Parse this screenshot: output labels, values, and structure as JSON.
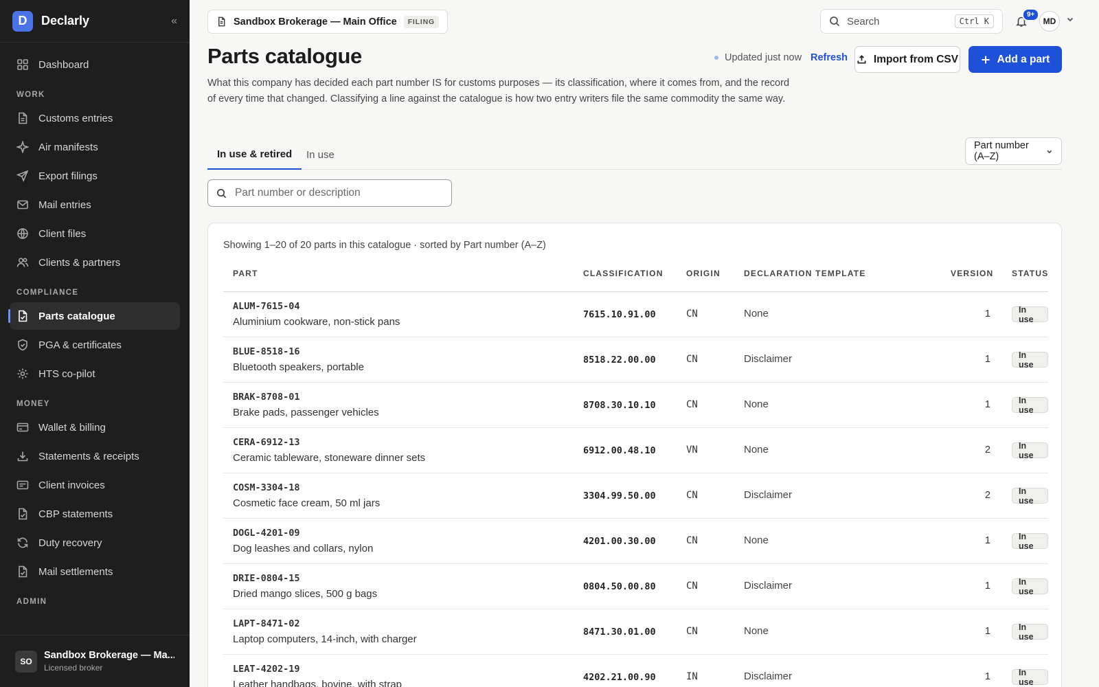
{
  "app": {
    "name": "Declarly",
    "logo_letter": "D"
  },
  "sidebar": {
    "top_items": [
      {
        "label": "Dashboard",
        "icon": "grid-icon"
      }
    ],
    "sections": [
      {
        "title": "WORK",
        "items": [
          {
            "label": "Customs entries",
            "icon": "document-icon"
          },
          {
            "label": "Air manifests",
            "icon": "sparkle-icon"
          },
          {
            "label": "Export filings",
            "icon": "send-icon"
          },
          {
            "label": "Mail entries",
            "icon": "mail-icon"
          },
          {
            "label": "Client files",
            "icon": "globe-icon"
          },
          {
            "label": "Clients & partners",
            "icon": "users-icon"
          }
        ]
      },
      {
        "title": "COMPLIANCE",
        "items": [
          {
            "label": "Parts catalogue",
            "icon": "file-check-icon",
            "active": true
          },
          {
            "label": "PGA & certificates",
            "icon": "shield-icon"
          },
          {
            "label": "HTS co-pilot",
            "icon": "sun-icon"
          }
        ]
      },
      {
        "title": "MONEY",
        "items": [
          {
            "label": "Wallet & billing",
            "icon": "card-icon"
          },
          {
            "label": "Statements & receipts",
            "icon": "download-icon"
          },
          {
            "label": "Client invoices",
            "icon": "invoice-icon"
          },
          {
            "label": "CBP statements",
            "icon": "file-check-icon"
          },
          {
            "label": "Duty recovery",
            "icon": "refresh-icon"
          },
          {
            "label": "Mail settlements",
            "icon": "file-check-icon"
          }
        ]
      },
      {
        "title": "ADMIN",
        "items": []
      }
    ],
    "account": {
      "initials": "SO",
      "name": "Sandbox Brokerage — Ma...",
      "role": "Licensed broker"
    }
  },
  "header": {
    "office": "Sandbox Brokerage — Main Office",
    "office_tag": "FILING",
    "search_label": "Search",
    "search_shortcut": "Ctrl K",
    "notif_badge": "9+",
    "user_initials": "MD"
  },
  "page": {
    "title": "Parts catalogue",
    "description": "What this company has decided each part number IS for customs purposes — its classification, where it comes from, and the record of every time that changed. Classifying a line against the catalogue is how two entry writers file the same commodity the same way.",
    "updated": "Updated just now",
    "refresh": "Refresh",
    "import_label": "Import from CSV",
    "add_label": "Add a part",
    "tabs": [
      "In use & retired",
      "In use"
    ],
    "sort_value": "Part number (A–Z)",
    "filter_placeholder": "Part number or description",
    "showing": "Showing 1–20 of 20 parts in this catalogue · sorted by Part number (A–Z)"
  },
  "table": {
    "columns": [
      "PART",
      "CLASSIFICATION",
      "ORIGIN",
      "DECLARATION TEMPLATE",
      "VERSION",
      "STATUS"
    ],
    "rows": [
      {
        "code": "ALUM-7615-04",
        "desc": "Aluminium cookware, non-stick pans",
        "class": "7615.10.91.00",
        "origin": "CN",
        "template": "None",
        "version": "1",
        "status": "In use"
      },
      {
        "code": "BLUE-8518-16",
        "desc": "Bluetooth speakers, portable",
        "class": "8518.22.00.00",
        "origin": "CN",
        "template": "Disclaimer",
        "version": "1",
        "status": "In use"
      },
      {
        "code": "BRAK-8708-01",
        "desc": "Brake pads, passenger vehicles",
        "class": "8708.30.10.10",
        "origin": "CN",
        "template": "None",
        "version": "1",
        "status": "In use"
      },
      {
        "code": "CERA-6912-13",
        "desc": "Ceramic tableware, stoneware dinner sets",
        "class": "6912.00.48.10",
        "origin": "VN",
        "template": "None",
        "version": "2",
        "status": "In use"
      },
      {
        "code": "COSM-3304-18",
        "desc": "Cosmetic face cream, 50 ml jars",
        "class": "3304.99.50.00",
        "origin": "CN",
        "template": "Disclaimer",
        "version": "2",
        "status": "In use"
      },
      {
        "code": "DOGL-4201-09",
        "desc": "Dog leashes and collars, nylon",
        "class": "4201.00.30.00",
        "origin": "CN",
        "template": "None",
        "version": "1",
        "status": "In use"
      },
      {
        "code": "DRIE-0804-15",
        "desc": "Dried mango slices, 500 g bags",
        "class": "0804.50.00.80",
        "origin": "CN",
        "template": "Disclaimer",
        "version": "1",
        "status": "In use"
      },
      {
        "code": "LAPT-8471-02",
        "desc": "Laptop computers, 14-inch, with charger",
        "class": "8471.30.01.00",
        "origin": "CN",
        "template": "None",
        "version": "1",
        "status": "In use"
      },
      {
        "code": "LEAT-4202-19",
        "desc": "Leather handbags, bovine, with strap",
        "class": "4202.21.00.90",
        "origin": "IN",
        "template": "Disclaimer",
        "version": "1",
        "status": "In use"
      }
    ]
  },
  "colors": {
    "accent": "#1e50d8",
    "sidebar_bg": "#1e1e1e",
    "page_bg": "#f7f7f6"
  }
}
